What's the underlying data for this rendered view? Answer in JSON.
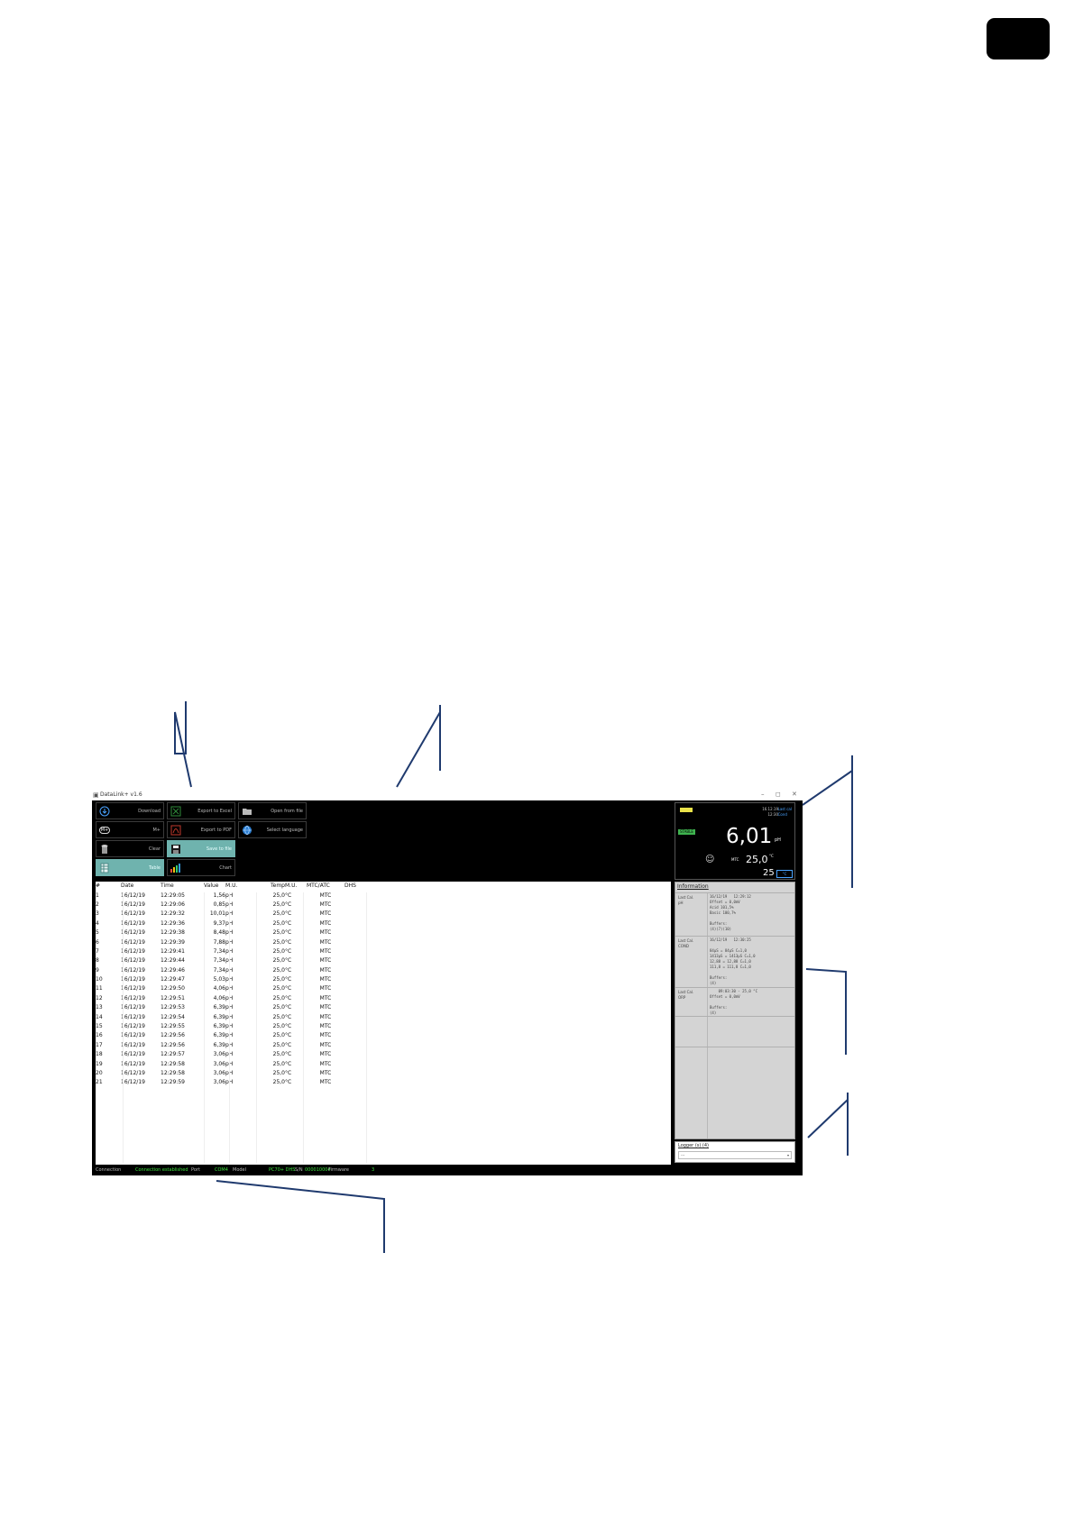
{
  "window": {
    "title": "DataLink+ v1.6"
  },
  "toolbar": {
    "download": "Download",
    "m_plus": "M+",
    "clear": "Clear",
    "table": "Table",
    "export_excel": "Export to Excel",
    "export_pdf": "Export to PDF",
    "save_file": "Save to file",
    "chart": "Chart",
    "open_file": "Open from file",
    "select_language": "Select language",
    "m_plus_icon_text": "M+"
  },
  "meter": {
    "battery": "",
    "date": "16.12.19",
    "time": "12:30",
    "cal_top": "Last cal",
    "cal_bottom": "Cond",
    "stable": "STABLE",
    "value": "6,01",
    "unit": "pH",
    "mtc": "MTC",
    "temperature": "25,0",
    "temp_unit": "°C",
    "atc_value": "25",
    "atc_box": "°C"
  },
  "table": {
    "headers": [
      "#",
      "Date",
      "Time",
      "Value",
      "M.U.",
      "Temp",
      "M.U.",
      "MTC/ATC",
      "DHS"
    ],
    "rows": [
      [
        "1",
        "16/12/19",
        "12:29:05",
        "1,56",
        "pH",
        "25,0",
        "°C",
        "MTC",
        ""
      ],
      [
        "2",
        "16/12/19",
        "12:29:06",
        "0,85",
        "pH",
        "25,0",
        "°C",
        "MTC",
        ""
      ],
      [
        "3",
        "16/12/19",
        "12:29:32",
        "10,01",
        "pH",
        "25,0",
        "°C",
        "MTC",
        ""
      ],
      [
        "4",
        "16/12/19",
        "12:29:36",
        "9,37",
        "pH",
        "25,0",
        "°C",
        "MTC",
        ""
      ],
      [
        "5",
        "16/12/19",
        "12:29:38",
        "8,48",
        "pH",
        "25,0",
        "°C",
        "MTC",
        ""
      ],
      [
        "6",
        "16/12/19",
        "12:29:39",
        "7,88",
        "pH",
        "25,0",
        "°C",
        "MTC",
        ""
      ],
      [
        "7",
        "16/12/19",
        "12:29:41",
        "7,34",
        "pH",
        "25,0",
        "°C",
        "MTC",
        ""
      ],
      [
        "8",
        "16/12/19",
        "12:29:44",
        "7,34",
        "pH",
        "25,0",
        "°C",
        "MTC",
        ""
      ],
      [
        "9",
        "16/12/19",
        "12:29:46",
        "7,34",
        "pH",
        "25,0",
        "°C",
        "MTC",
        ""
      ],
      [
        "10",
        "16/12/19",
        "12:29:47",
        "5,03",
        "pH",
        "25,0",
        "°C",
        "MTC",
        ""
      ],
      [
        "11",
        "16/12/19",
        "12:29:50",
        "4,06",
        "pH",
        "25,0",
        "°C",
        "MTC",
        ""
      ],
      [
        "12",
        "16/12/19",
        "12:29:51",
        "4,06",
        "pH",
        "25,0",
        "°C",
        "MTC",
        ""
      ],
      [
        "13",
        "16/12/19",
        "12:29:53",
        "6,39",
        "pH",
        "25,0",
        "°C",
        "MTC",
        ""
      ],
      [
        "14",
        "16/12/19",
        "12:29:54",
        "6,39",
        "pH",
        "25,0",
        "°C",
        "MTC",
        ""
      ],
      [
        "15",
        "16/12/19",
        "12:29:55",
        "6,39",
        "pH",
        "25,0",
        "°C",
        "MTC",
        ""
      ],
      [
        "16",
        "16/12/19",
        "12:29:56",
        "6,39",
        "pH",
        "25,0",
        "°C",
        "MTC",
        ""
      ],
      [
        "17",
        "16/12/19",
        "12:29:56",
        "6,39",
        "pH",
        "25,0",
        "°C",
        "MTC",
        ""
      ],
      [
        "18",
        "16/12/19",
        "12:29:57",
        "3,06",
        "pH",
        "25,0",
        "°C",
        "MTC",
        ""
      ],
      [
        "19",
        "16/12/19",
        "12:29:58",
        "3,06",
        "pH",
        "25,0",
        "°C",
        "MTC",
        ""
      ],
      [
        "20",
        "16/12/19",
        "12:29:58",
        "3,06",
        "pH",
        "25,0",
        "°C",
        "MTC",
        ""
      ],
      [
        "21",
        "16/12/19",
        "12:29:59",
        "3,06",
        "pH",
        "25,0",
        "°C",
        "MTC",
        ""
      ]
    ]
  },
  "info": {
    "title": "Information",
    "sections": [
      {
        "label": "Last Cal.\npH",
        "value": "16/12/19   12:29:12\nOffset = 0,0mV\nAcid 101,5%\nBasic 100,7%\n\nBuffers:\n(4)(7)(10)"
      },
      {
        "label": "Last Cal.\nCOND",
        "value": "16/12/19   12:30:25\n\n84µS = 84µS C=1,0\n1413µS = 1413µS C=1,0\n12,88 = 12,88 C=1,0\n111,8 = 111,8 C=1,0\n\nBuffers:\n(4)"
      },
      {
        "label": "Last Cal.\nORP",
        "value": "    09:03:30 - 25,0 °C\nOffset = 0,0mV\n\nBuffers:\n(4)"
      },
      {
        "label": "",
        "value": ""
      },
      {
        "label": "",
        "value": ""
      }
    ]
  },
  "logger": {
    "label": "Logger (s) (4)",
    "value": "---"
  },
  "status": {
    "connection_label": "Connection",
    "connection_value": "Connection established",
    "port_label": "Port",
    "port_value": "COM4",
    "model_label": "Model",
    "model_value": "PC70+ DHS",
    "sn_label": "S/N",
    "sn_value": "000010004",
    "firmware_label": "Firmware",
    "firmware_value": "3"
  },
  "colors": {
    "accent": "#6fb3ae",
    "status_green": "#3fe03f",
    "callout_line": "#1f3a6e",
    "battery": "#e9e24a"
  }
}
